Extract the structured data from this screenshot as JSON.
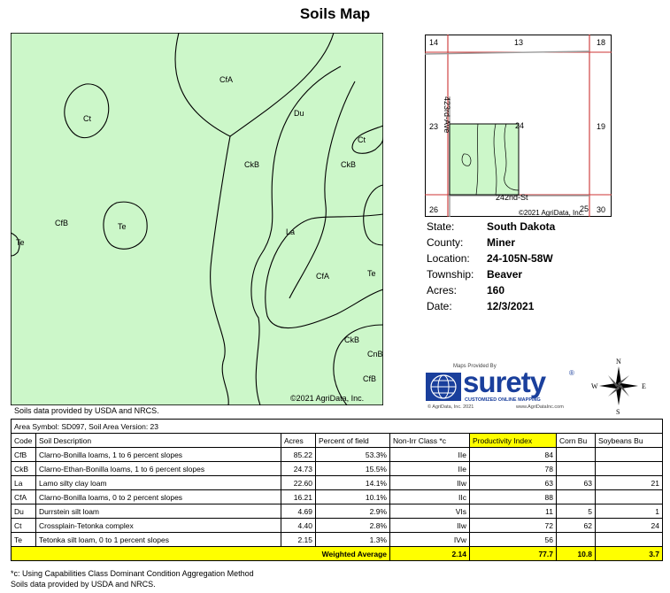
{
  "title": "Soils Map",
  "map": {
    "copyright": "©2021 AgriData, Inc.",
    "labels": {
      "cfa_top": "CfA",
      "ct_left": "Ct",
      "du": "Du",
      "ct_right": "Ct",
      "ckb_left": "CkB",
      "ckb_right": "CkB",
      "cfb": "CfB",
      "te_center": "Te",
      "te_left": "Te",
      "la": "La",
      "cfa_bottom": "CfA",
      "te_right": "Te",
      "ckb_bottom": "CkB",
      "cnb": "CnB",
      "cfb_bottom": "CfB"
    }
  },
  "locator": {
    "sections": {
      "s14": "14",
      "s13": "13",
      "s18": "18",
      "s23": "23",
      "s24": "24",
      "s19": "19",
      "s26": "26",
      "s25": "25",
      "s30": "30"
    },
    "road_ave": "423rd-Ave",
    "road_st": "242nd-St",
    "copyright": "©2021 AgriData, Inc."
  },
  "info": {
    "state_label": "State:",
    "state": "South Dakota",
    "county_label": "County:",
    "county": "Miner",
    "location_label": "Location:",
    "location": "24-105N-58W",
    "township_label": "Township:",
    "township": "Beaver",
    "acres_label": "Acres:",
    "acres": "160",
    "date_label": "Date:",
    "date": "12/3/2021"
  },
  "logo": {
    "maps_by": "Maps Provided By",
    "name": "surety",
    "registered": "®",
    "tagline": "CUSTOMIZED ONLINE MAPPING",
    "footer_left": "© AgriData, Inc. 2021",
    "footer_right": "www.AgriDataInc.com"
  },
  "compass": {
    "n": "N",
    "s": "S",
    "e": "E",
    "w": "W"
  },
  "map_note": "Soils data provided by USDA and NRCS.",
  "table": {
    "area_row": "Area Symbol: SD097, Soil Area Version: 23",
    "headers": [
      "Code",
      "Soil Description",
      "Acres",
      "Percent of field",
      "Non-Irr Class *c",
      "Productivity Index",
      "Corn Bu",
      "Soybeans Bu"
    ],
    "rows": [
      [
        "CfB",
        "Clarno-Bonilla loams, 1 to 6 percent slopes",
        "85.22",
        "53.3%",
        "IIe",
        "84",
        "",
        ""
      ],
      [
        "CkB",
        "Clarno-Ethan-Bonilla loams, 1 to 6 percent slopes",
        "24.73",
        "15.5%",
        "IIe",
        "78",
        "",
        ""
      ],
      [
        "La",
        "Lamo silty clay loam",
        "22.60",
        "14.1%",
        "IIw",
        "63",
        "63",
        "21"
      ],
      [
        "CfA",
        "Clarno-Bonilla loams, 0 to 2 percent slopes",
        "16.21",
        "10.1%",
        "IIc",
        "88",
        "",
        ""
      ],
      [
        "Du",
        "Durrstein silt loam",
        "4.69",
        "2.9%",
        "VIs",
        "11",
        "5",
        "1"
      ],
      [
        "Ct",
        "Crossplain-Tetonka complex",
        "4.40",
        "2.8%",
        "IIw",
        "72",
        "62",
        "24"
      ],
      [
        "Te",
        "Tetonka silt loam, 0 to 1 percent slopes",
        "2.15",
        "1.3%",
        "IVw",
        "56",
        "",
        ""
      ]
    ],
    "total": {
      "label": "Weighted Average",
      "non_irr": "2.14",
      "pi": "77.7",
      "corn": "10.8",
      "soy": "3.7"
    }
  },
  "footnotes": [
    "*c: Using Capabilities Class Dominant Condition Aggregation Method",
    "Soils data provided by USDA and NRCS."
  ]
}
